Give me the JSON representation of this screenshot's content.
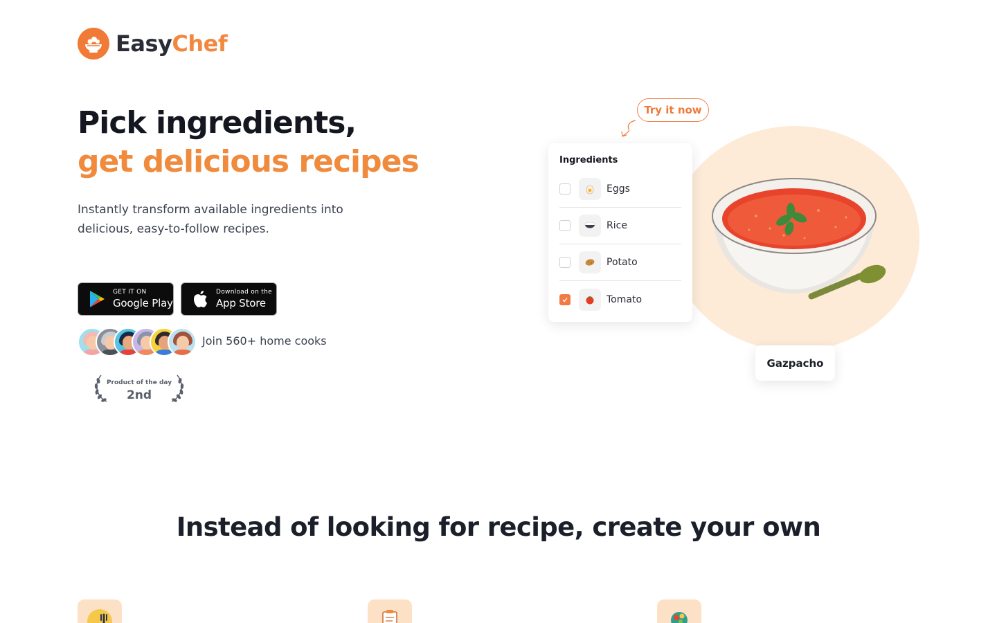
{
  "brand": {
    "name_part1": "Easy",
    "name_part2": "Chef",
    "accent": "#f2883f"
  },
  "hero": {
    "title_line1": "Pick ingredients,",
    "title_line2": "get delicious recipes",
    "subtitle": "Instantly transform available ingredients into delicious, easy-to-follow recipes."
  },
  "stores": {
    "google_small": "GET IT ON",
    "google_big": "Google Play",
    "apple_small": "Download on the",
    "apple_big": "App Store"
  },
  "social": {
    "join_text": "Join 560+ home cooks",
    "award_label": "Product of the day",
    "award_rank": "2nd"
  },
  "demo": {
    "try_label": "Try it now",
    "card_title": "Ingredients",
    "ingredients": [
      {
        "label": "Eggs",
        "checked": false,
        "icon": "egg-icon"
      },
      {
        "label": "Rice",
        "checked": false,
        "icon": "rice-icon"
      },
      {
        "label": "Potato",
        "checked": false,
        "icon": "potato-icon"
      },
      {
        "label": "Tomato",
        "checked": true,
        "icon": "tomato-icon"
      }
    ],
    "dish_name": "Gazpacho"
  },
  "features": {
    "title": "Instead of looking for recipe, create your own",
    "icons": [
      "chef-icon",
      "clipboard-icon",
      "salad-icon"
    ]
  }
}
